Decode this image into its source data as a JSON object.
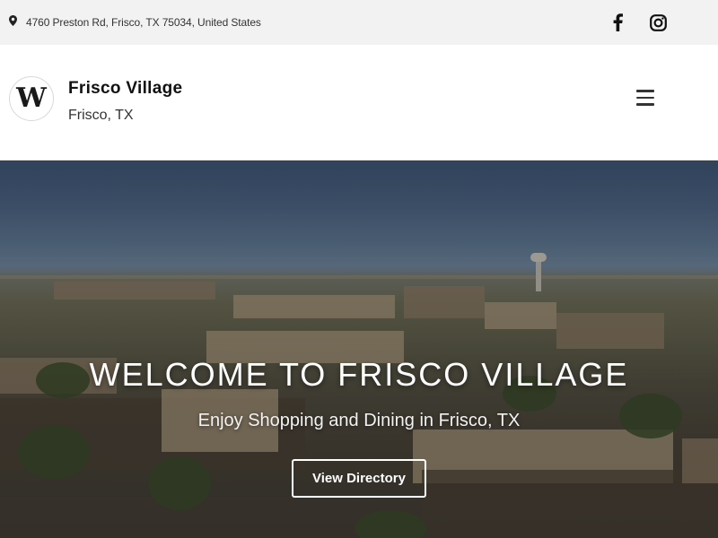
{
  "topbar": {
    "address": "4760 Preston Rd, Frisco, TX 75034, United States",
    "icons": [
      "map-pin-icon",
      "facebook-icon",
      "instagram-icon"
    ]
  },
  "header": {
    "logo_letter": "W",
    "title": "Frisco Village",
    "subtitle": "Frisco, TX",
    "menu_icon": "hamburger-menu-icon"
  },
  "hero": {
    "title": "WELCOME TO FRISCO VILLAGE",
    "subtitle": "Enjoy Shopping and Dining in Frisco, TX",
    "button_label": "View Directory"
  },
  "colors": {
    "topbar_bg": "#f2f2f2",
    "header_bg": "#ffffff",
    "text_dark": "#111111",
    "hero_text": "#ffffff"
  }
}
